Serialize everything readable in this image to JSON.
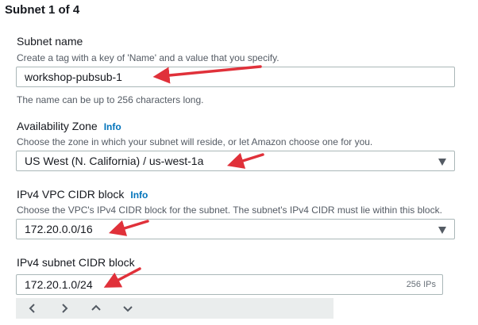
{
  "section": {
    "title": "Subnet 1 of 4"
  },
  "subnet_name": {
    "label": "Subnet name",
    "description": "Create a tag with a key of 'Name' and a value that you specify.",
    "value": "workshop-pubsub-1",
    "hint": "The name can be up to 256 characters long."
  },
  "availability_zone": {
    "label": "Availability Zone",
    "info": "Info",
    "description": "Choose the zone in which your subnet will reside, or let Amazon choose one for you.",
    "value": "US West (N. California) / us-west-1a"
  },
  "vpc_cidr": {
    "label": "IPv4 VPC CIDR block",
    "info": "Info",
    "description": "Choose the VPC's IPv4 CIDR block for the subnet. The subnet's IPv4 CIDR must lie within this block.",
    "value": "172.20.0.0/16"
  },
  "subnet_cidr": {
    "label": "IPv4 subnet CIDR block",
    "value": "172.20.1.0/24",
    "ip_count": "256 IPs",
    "stepper_icons": [
      "chevron-left-icon",
      "chevron-right-icon",
      "chevron-up-icon",
      "chevron-down-icon"
    ]
  },
  "colors": {
    "annotation_arrow": "#e0313a",
    "info_link": "#0073bb",
    "border": "#aab7b8"
  }
}
